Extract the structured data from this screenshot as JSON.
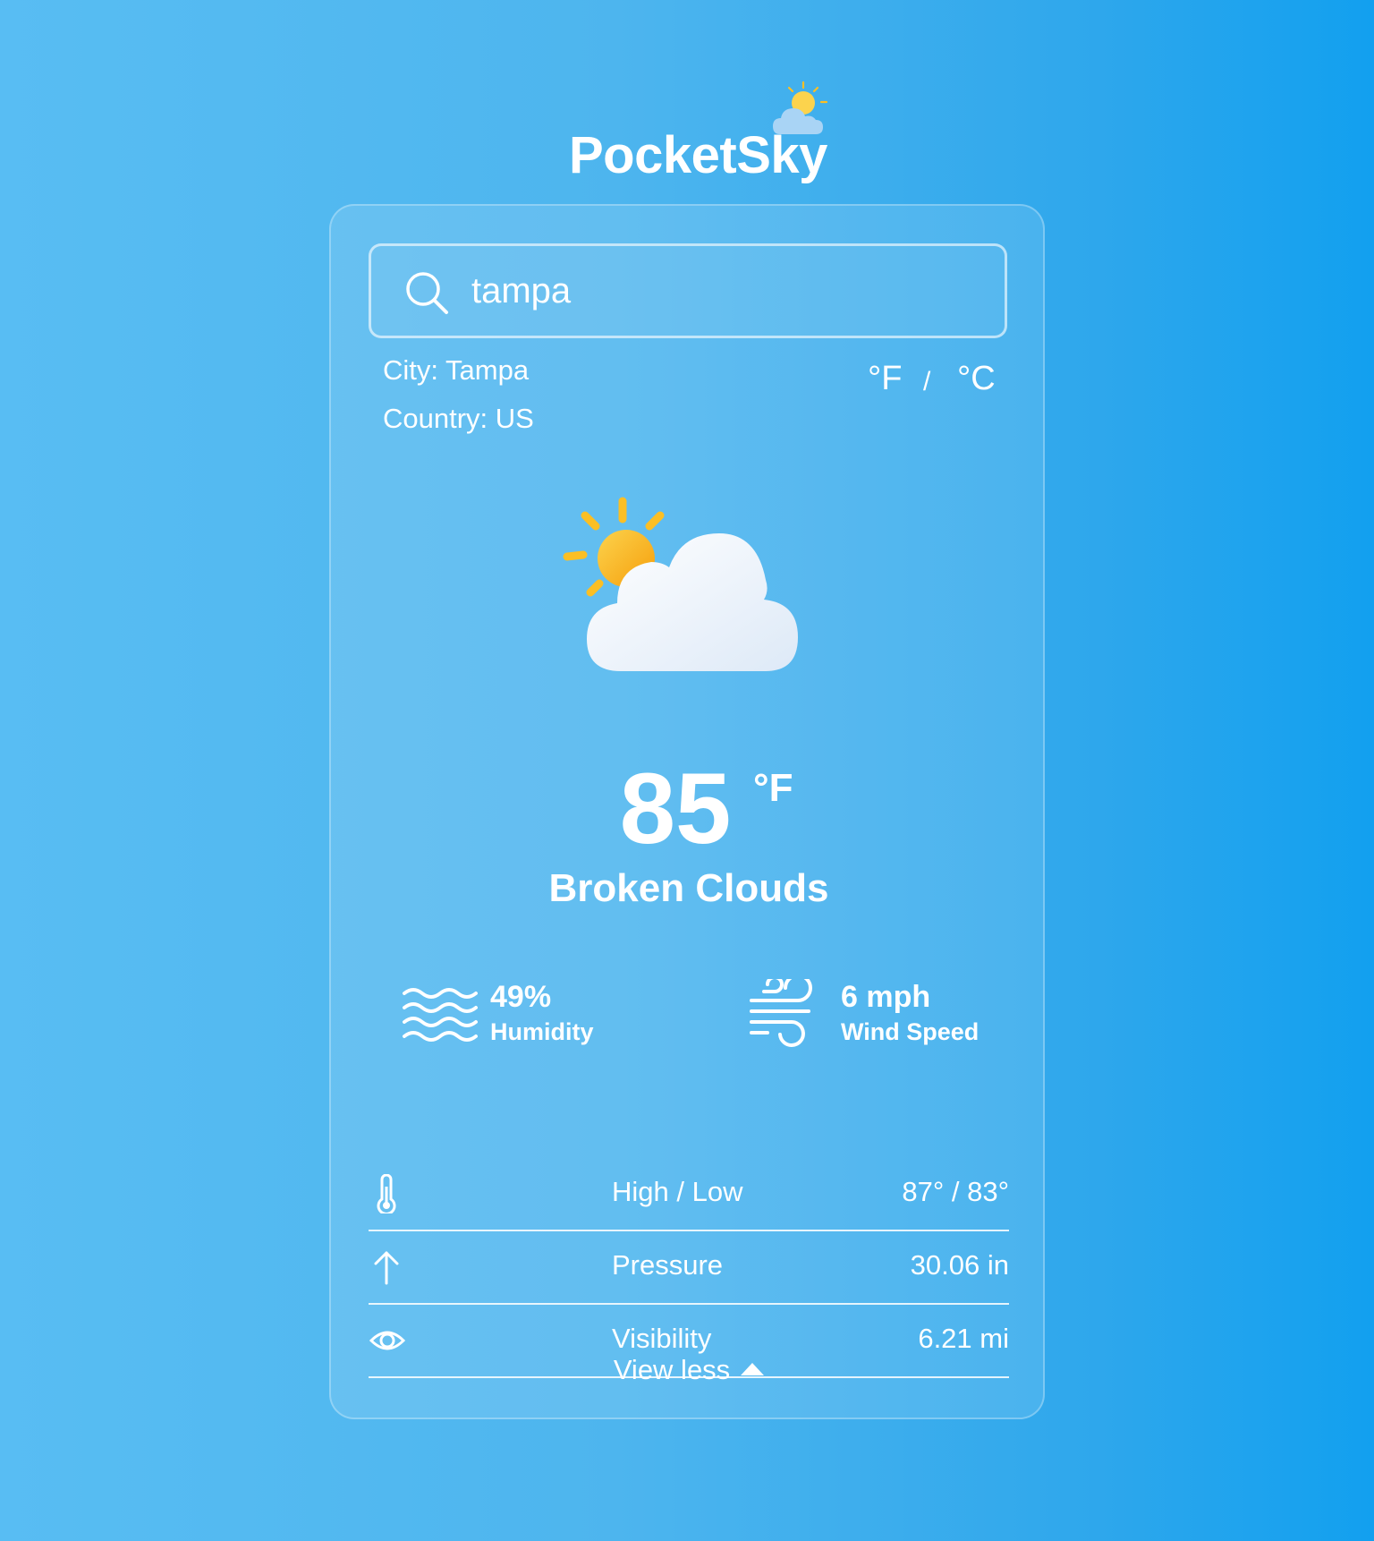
{
  "app": {
    "title": "PocketSky"
  },
  "search": {
    "value": "tampa",
    "placeholder": ""
  },
  "location": {
    "city_line": "City: Tampa",
    "country_line": "Country: US"
  },
  "units": {
    "fahrenheit": "°F",
    "separator": "/",
    "celsius": "°C",
    "selected": "°F"
  },
  "current": {
    "icon": "partly-cloudy-icon",
    "temperature": "85",
    "unit": "°F",
    "condition": "Broken Clouds"
  },
  "stats": {
    "humidity": {
      "value": "49%",
      "label": "Humidity",
      "icon": "humidity-waves-icon"
    },
    "wind": {
      "value": "6 mph",
      "label": "Wind Speed",
      "icon": "wind-icon"
    }
  },
  "details": [
    {
      "icon": "thermometer-icon",
      "label": "High / Low",
      "value": "87° / 83°"
    },
    {
      "icon": "arrow-up-icon",
      "label": "Pressure",
      "value": "30.06 in"
    },
    {
      "icon": "eye-icon",
      "label": "Visibility",
      "value": "6.21 mi"
    }
  ],
  "toggle": {
    "label": "View less",
    "icon": "caret-up-icon"
  },
  "colors": {
    "background_start": "#58bdf3",
    "background_end": "#12a0ef",
    "sun": "#fbbf24",
    "text": "#ffffff"
  }
}
